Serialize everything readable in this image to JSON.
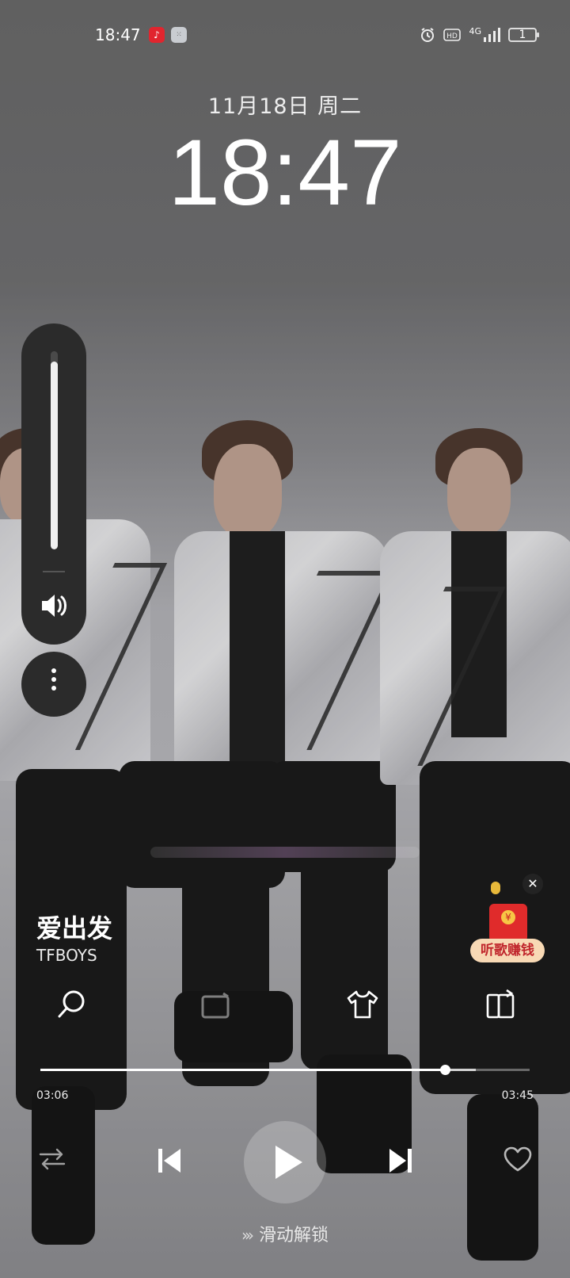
{
  "status_bar": {
    "time": "18:47",
    "network": "4G",
    "battery": "1"
  },
  "lockscreen": {
    "date": "11月18日 周二",
    "clock": "18:47"
  },
  "volume": {
    "level": 0.95
  },
  "player": {
    "title": "爱出发",
    "artist": "TFBOYS",
    "current_time": "03:06",
    "total_time": "03:45",
    "progress_fraction": 0.827,
    "ad_label": "听歌赚钱"
  },
  "unlock": {
    "label": "滑动解锁"
  },
  "icons": {
    "search": "search-icon",
    "live": "live-icon",
    "skin": "tshirt-icon",
    "lyrics": "lyric-poster-icon",
    "shuffle": "shuffle-icon",
    "prev": "previous-icon",
    "play": "play-icon",
    "next": "next-icon",
    "like": "heart-icon"
  }
}
